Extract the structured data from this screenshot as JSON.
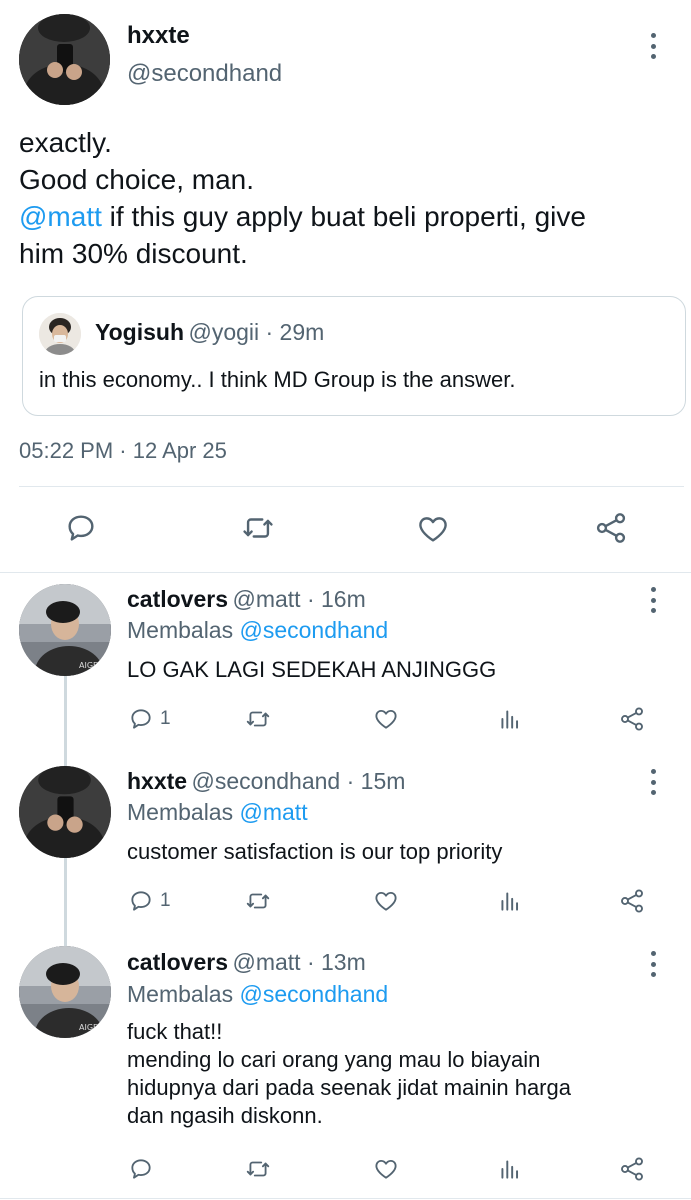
{
  "main_tweet": {
    "name": "hxxte",
    "handle": "@secondhand",
    "text_lines": [
      "exactly.",
      "Good choice, man."
    ],
    "mention": "@matt",
    "text_after_mention": " if this guy apply buat beli properti, give",
    "text_last_line": "him 30% discount.",
    "quote": {
      "name": "Yogisuh",
      "handle_time": "@yogii · 29m",
      "text": "in this economy.. I think MD Group is the answer."
    },
    "timestamp": "05:22 PM · 12 Apr 25",
    "actions": [
      "reply-icon",
      "retweet-icon",
      "like-icon",
      "share-icon"
    ]
  },
  "replies": [
    {
      "name": "catlovers",
      "handle_time": "@matt · 16m",
      "replying_prefix": "Membalas",
      "replying_to": "@secondhand",
      "text_lines": [
        "LO GAK LAGI SEDEKAH ANJINGGG"
      ],
      "reply_count": "1"
    },
    {
      "name": "hxxte",
      "handle_time": "@secondhand · 15m",
      "replying_prefix": "Membalas",
      "replying_to": "@matt",
      "text_lines": [
        "customer satisfaction is our top priority"
      ],
      "reply_count": "1"
    },
    {
      "name": "catlovers",
      "handle_time": "@matt · 13m",
      "replying_prefix": "Membalas",
      "replying_to": "@secondhand",
      "text_lines": [
        "fuck that!!",
        "mending lo cari orang yang mau lo biayain",
        "hidupnya dari pada seenak jidat mainin harga",
        "dan ngasih diskonn."
      ],
      "reply_count": ""
    }
  ],
  "colors": {
    "link": "#1d9bf0",
    "secondary_text": "#536471",
    "primary_text": "#0f1419",
    "border": "#cfd9de"
  }
}
